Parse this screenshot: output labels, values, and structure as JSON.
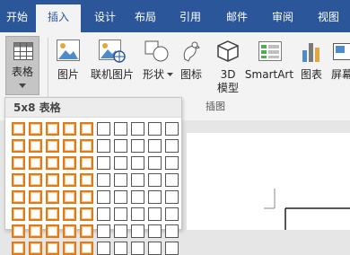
{
  "tabs": [
    {
      "label": "开始",
      "active": false
    },
    {
      "label": "插入",
      "active": true
    },
    {
      "label": "设计",
      "active": false
    },
    {
      "label": "布局",
      "active": false
    },
    {
      "label": "引用",
      "active": false
    },
    {
      "label": "邮件",
      "active": false
    },
    {
      "label": "审阅",
      "active": false
    },
    {
      "label": "视图",
      "active": false
    }
  ],
  "ribbon": {
    "table_label": "表格",
    "picture_label": "图片",
    "online_picture_label": "联机图片",
    "shapes_label": "形状",
    "icons_label": "图标",
    "model3d_label_line1": "3D",
    "model3d_label_line2": "模型",
    "smartart_label": "SmartArt",
    "chart_label": "图表",
    "screenshot_label": "屏幕",
    "group_illustrations": "插图"
  },
  "table_dropdown": {
    "header": "5x8 表格",
    "columns": 10,
    "rows": 8,
    "selected_cols": 5,
    "selected_rows": 8,
    "highlight_color": "#e07b17"
  },
  "colors": {
    "accent": "#2b579a",
    "ribbon_bg": "#f3f3f3"
  }
}
